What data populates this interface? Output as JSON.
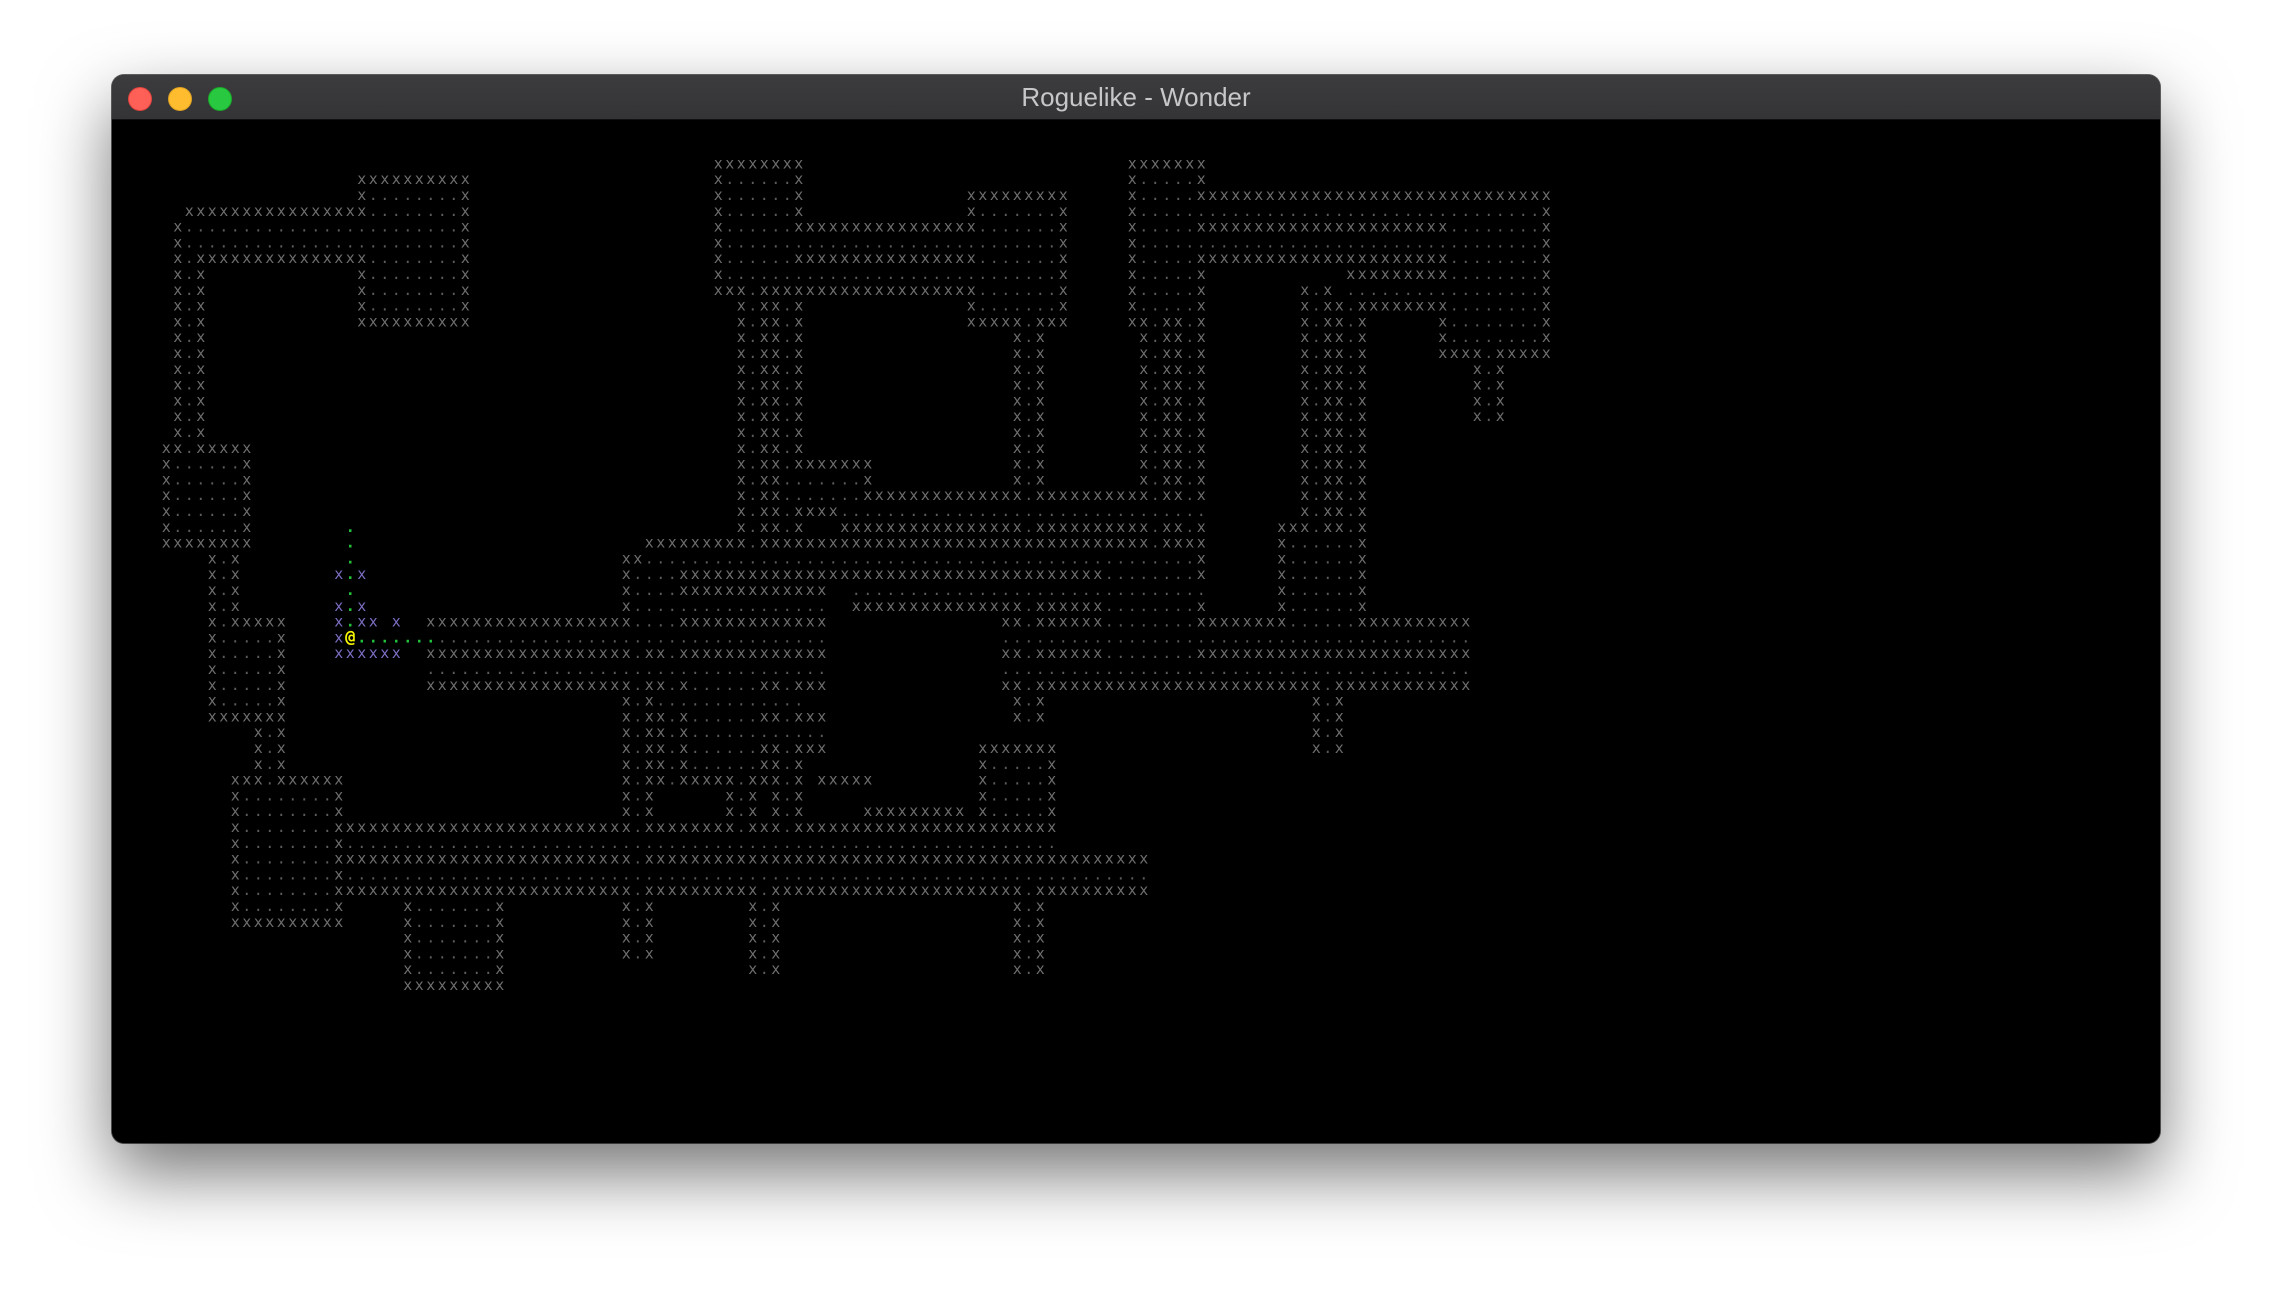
{
  "window": {
    "title": "Roguelike - Wonder"
  },
  "titlebar_buttons": [
    {
      "name": "close-button",
      "color": "#fe5f57"
    },
    {
      "name": "minimize-button",
      "color": "#febc2e"
    },
    {
      "name": "zoom-button",
      "color": "#28c840"
    }
  ],
  "glyphs": {
    "wall": "x",
    "floor": ".",
    "player": "@"
  },
  "colors": {
    "background": "#000000",
    "wall_remembered": "#6e6e6e",
    "floor_remembered": "#5c5c5c",
    "wall_visible": "#7a6fc4",
    "floor_visible": "#22c33a",
    "player": "#f5f500"
  }
}
